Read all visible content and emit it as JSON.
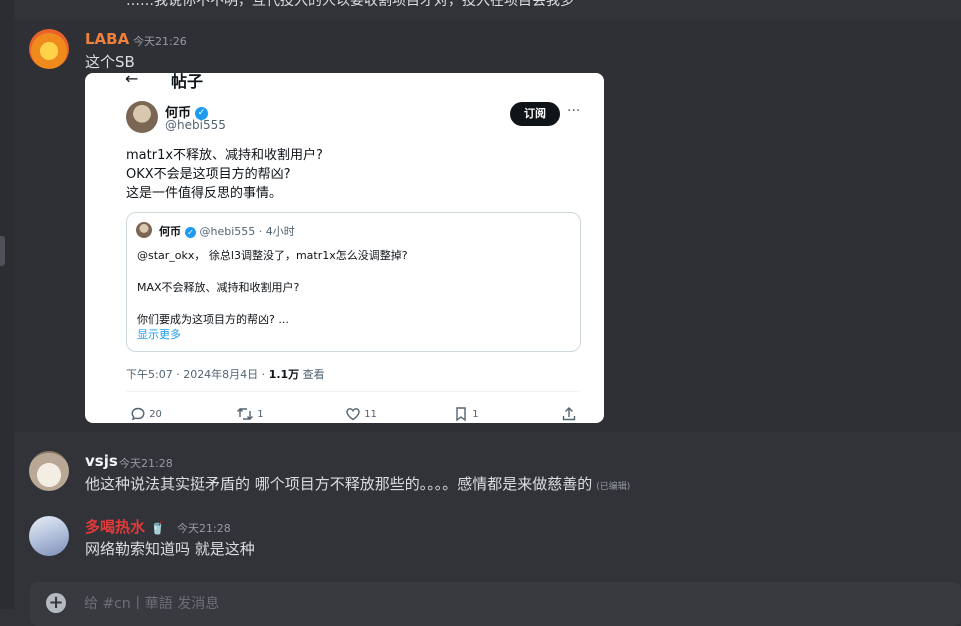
{
  "top_fragment": {
    "text": "……我说你不不明，互代投入的人以要收割项目才对，投入在项目会我多"
  },
  "messages": [
    {
      "author": "LABA",
      "author_color": "#f0803c",
      "timestamp": "今天21:26",
      "text": "这个SB"
    },
    {
      "author": "vsjs",
      "author_color": "#f2f3f5",
      "timestamp": "今天21:28",
      "text": "他这种说法其实挺矛盾的  哪个项目方不释放那些的。。。。感情都是来做慈善的",
      "edited": "(已编辑)"
    },
    {
      "author": "多喝热水",
      "author_color": "#e03a3a",
      "badge": "🥤",
      "timestamp": "今天21:28",
      "text": "网络勒索知道吗  就是这种"
    }
  ],
  "embed": {
    "back": "←",
    "page_title": "帖子",
    "name": "何币",
    "verified": "✓",
    "handle": "@hebi555",
    "subscribe": "订阅",
    "more": "···",
    "body_lines": [
      "matr1x不释放、减持和收割用户?",
      "OKX不会是这项目方的帮凶?",
      "这是一件值得反思的事情。"
    ],
    "quote": {
      "name": "何币",
      "handle_time": "@hebi555 · 4小时",
      "lines": [
        "@star_okx， 徐总l3调整没了，matr1x怎么没调整掉?",
        "MAX不会释放、减持和收割用户?",
        "你们要成为这项目方的帮凶? ..."
      ],
      "show_more": "显示更多"
    },
    "meta_time": "下午5:07 · 2024年8月4日 · ",
    "meta_views": "1.1万",
    "meta_suffix": " 查看",
    "actions": {
      "replies": "20",
      "retweets": "1",
      "likes": "11",
      "bookmarks": "1"
    }
  },
  "input": {
    "placeholder": "给 #cn丨華語 发消息"
  }
}
